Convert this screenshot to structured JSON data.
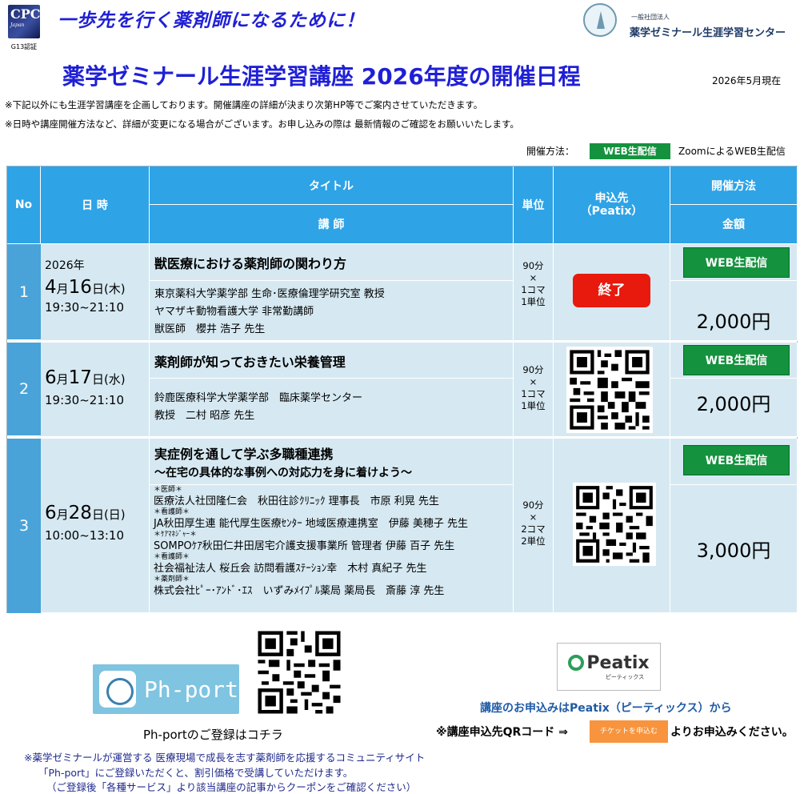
{
  "header": {
    "logo_text": "CPC",
    "logo_sub": "Japan",
    "cert": "G13認証",
    "slogan": "一歩先を行く薬剤師になるために！",
    "org_small": "一般社団法人",
    "org_name": "薬学ゼミナール生涯学習センター",
    "title": "薬学ゼミナール生涯学習講座 2026年度の開催日程",
    "as_of": "2026年5月現在"
  },
  "notes": [
    "※下記以外にも生涯学習講座を企画しております。開催講座の詳細が決まり次第HP等でご案内させていただきます。",
    "※日時や講座開催方法など、詳細が変更になる場合がございます。お申し込みの際は 最新情報のご確認をお願いいたします。"
  ],
  "legend": {
    "label": "開催方法：",
    "badge": "WEB生配信",
    "desc": "ZoomによるWEB生配信"
  },
  "table": {
    "headers": {
      "no": "No",
      "date": "日 時",
      "title": "タイトル",
      "instructor": "講 師",
      "unit": "単位",
      "apply": "申込先\n（Peatix）",
      "method": "開催方法",
      "price": "金額"
    },
    "rows": [
      {
        "no": "1",
        "year": "2026年",
        "month": "4",
        "month_suffix": "月",
        "day": "16",
        "day_suffix": "日",
        "weekday": "(木)",
        "time": "19:30~21:10",
        "title": "獣医療における薬剤師の関わり方",
        "instructor_lines": [
          "東京薬科大学薬学部 生命･医療倫理学研究室 教授",
          "ヤマザキ動物看護大学 非常勤講師",
          "獣医師　櫻井 浩子 先生"
        ],
        "unit_lines": [
          "90分",
          "×",
          "1コマ",
          "1単位"
        ],
        "apply_status": "終了",
        "method": "WEB生配信",
        "price": "2,000円"
      },
      {
        "no": "2",
        "month": "6",
        "month_suffix": "月",
        "day": "17",
        "day_suffix": "日",
        "weekday": "(水)",
        "time": "19:30~21:10",
        "title": "薬剤師が知っておきたい栄養管理",
        "instructor_lines": [
          "鈴鹿医療科学大学薬学部　臨床薬学センター",
          "教授　二村 昭彦 先生"
        ],
        "unit_lines": [
          "90分",
          "×",
          "1コマ",
          "1単位"
        ],
        "method": "WEB生配信",
        "price": "2,000円"
      },
      {
        "no": "3",
        "month": "6",
        "month_suffix": "月",
        "day": "28",
        "day_suffix": "日",
        "weekday": "(日)",
        "time": "10:00~13:10",
        "title": "実症例を通して学ぶ多職種連携",
        "subtitle": "～在宅の具体的な事例への対応力を身に着けよう～",
        "instructors": [
          {
            "role": "＊医師＊",
            "line": "医療法人社団隆仁会　秋田往診ｸﾘﾆｯｸ 理事長　市原 利晃 先生"
          },
          {
            "role": "＊看護師＊",
            "line": "JA秋田厚生連 能代厚生医療ｾﾝﾀｰ 地域医療連携室　伊藤 美穂子 先生"
          },
          {
            "role": "＊ｹｱﾏﾈｼﾞｬｰ＊",
            "line": "SOMPOｹｱ秋田仁井田居宅介護支援事業所 管理者 伊藤 百子 先生"
          },
          {
            "role": "＊看護師＊",
            "line": "社会福祉法人 桜丘会 訪問看護ｽﾃｰｼｮﾝ幸　木村 真紀子 先生"
          },
          {
            "role": "＊薬剤師＊",
            "line": "株式会社ﾋﾟｰ･ｱﾝﾄﾞ･ｴｽ　いずみﾒｲﾌﾟﾙ薬局 薬局長　斎藤 淳 先生"
          }
        ],
        "unit_lines": [
          "90分",
          "×",
          "2コマ",
          "2単位"
        ],
        "method": "WEB生配信",
        "price": "3,000円"
      }
    ]
  },
  "bottom": {
    "phport_logo": "Ph-port",
    "phport_caption": "Ph-portのご登録はコチラ",
    "peatix_name": "Peatix",
    "peatix_kana": "ピーティックス",
    "apply_blue": "講座のお申込みはPeatix（ピーティックス）から",
    "apply_prefix": "※講座申込先QRコード ⇒",
    "ticket_btn": "チケットを申込む",
    "apply_suffix": "よりお申込みください。",
    "footnotes": [
      "※薬学ゼミナールが運営する 医療現場で成長を志す薬剤師を応援するコミュニティサイト",
      "「Ph-port」にご登録いただくと、割引価格で受講していただけます。",
      "（ご登録後「各種サービス」より該当講座の記事からクーポンをご確認ください）"
    ]
  },
  "colors": {
    "header_blue": "#2ea3e6",
    "cell_bg": "#d6e9f2",
    "badge_green": "#14923e",
    "end_red": "#e8190d",
    "title_blue": "#1f1fd6"
  }
}
